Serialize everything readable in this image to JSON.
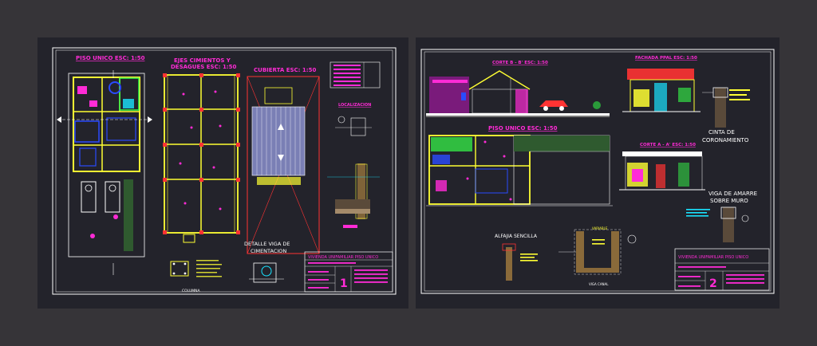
{
  "sheet1": {
    "plan_title": "PISO UNICO ESC: 1:50",
    "foundation_title_line1": "EJES CIMIENTOS Y",
    "foundation_title_line2": "DESAGUES ESC: 1:50",
    "roof_title": "CUBIERTA ESC: 1:50",
    "location_label": "LOCALIZACION",
    "beam_detail_line1": "DETALLE VIGA DE",
    "beam_detail_line2": "CIMENTACION",
    "column_label": "COLUMNA",
    "titleblock_name": "VIVIENDA UNIFAMILIAR PISO UNICO",
    "sheet_number": "1"
  },
  "sheet2": {
    "section_b_title": "CORTE B - B' ESC: 1:50",
    "facade_title": "FACHADA PPAL ESC: 1:50",
    "plan_title": "PISO UNICO ESC: 1:50",
    "section_a_title": "CORTE A - A' ESC: 1:50",
    "ring_beam_line1": "CINTA DE",
    "ring_beam_line2": "CORONAMIENTO",
    "tie_beam_line1": "VIGA DE AMARRE",
    "tie_beam_line2": "SOBRE MURO",
    "sill_label": "ALFAJIA SENCILLA",
    "channel_label": "VIGA CANAL",
    "variable_label": "VARIABLE",
    "titleblock_name": "VIVIENDA UNIFAMILIAR PISO UNICO",
    "sheet_number": "2"
  },
  "colors": {
    "background": "#363438",
    "sheet": "#23232b",
    "frame": "#ffffff",
    "title": "#ff2bd6",
    "walls": "#ffff33",
    "accent_cyan": "#19e3ff",
    "accent_green": "#36ff4a",
    "accent_red": "#ff3333",
    "accent_blue": "#2a4bff"
  }
}
